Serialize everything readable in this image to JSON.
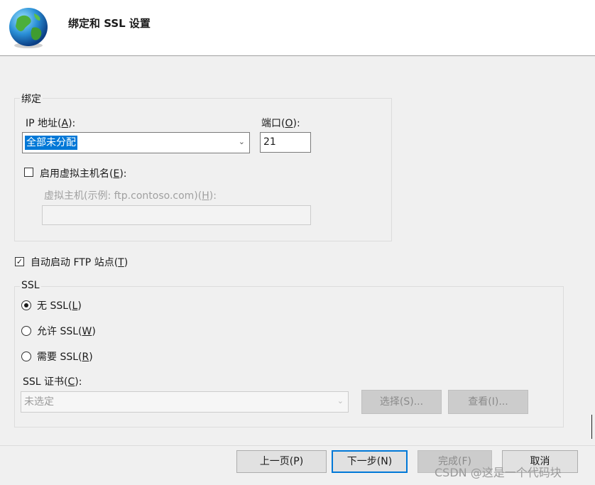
{
  "header": {
    "title": "绑定和 SSL 设置",
    "icon": "globe-icon"
  },
  "binding": {
    "legend": "绑定",
    "ip_label": "IP 地址(",
    "ip_key": "A",
    "ip_label_end": "):",
    "ip_value": "全部未分配",
    "port_label": "端口(",
    "port_key": "O",
    "port_label_end": "):",
    "port_value": "21",
    "vhost_check_label": "启用虚拟主机名(",
    "vhost_check_key": "E",
    "vhost_check_label_end": "):",
    "vhost_checked": false,
    "vhost_name_label": "虚拟主机(示例: ftp.contoso.com)(",
    "vhost_name_key": "H",
    "vhost_name_label_end": "):",
    "vhost_name_value": ""
  },
  "autostart": {
    "label": "自动启动 FTP 站点(",
    "key": "T",
    "label_end": ")",
    "checked": true
  },
  "ssl": {
    "legend": "SSL",
    "options": [
      {
        "label": "无 SSL(",
        "key": "L",
        "label_end": ")",
        "selected": true
      },
      {
        "label": "允许 SSL(",
        "key": "W",
        "label_end": ")",
        "selected": false
      },
      {
        "label": "需要 SSL(",
        "key": "R",
        "label_end": ")",
        "selected": false
      }
    ],
    "cert_label": "SSL 证书(",
    "cert_key": "C",
    "cert_label_end": "):",
    "cert_value": "未选定",
    "select_button": "选择(S)...",
    "view_button": "查看(I)..."
  },
  "footer": {
    "prev_button": "上一页(P)",
    "next_button": "下一步(N)",
    "finish_button": "完成(F)",
    "cancel_button": "取消"
  },
  "watermark": "CSDN @这是一个代码块",
  "colors": {
    "accent": "#0078d7",
    "background": "#f0f0f0"
  }
}
